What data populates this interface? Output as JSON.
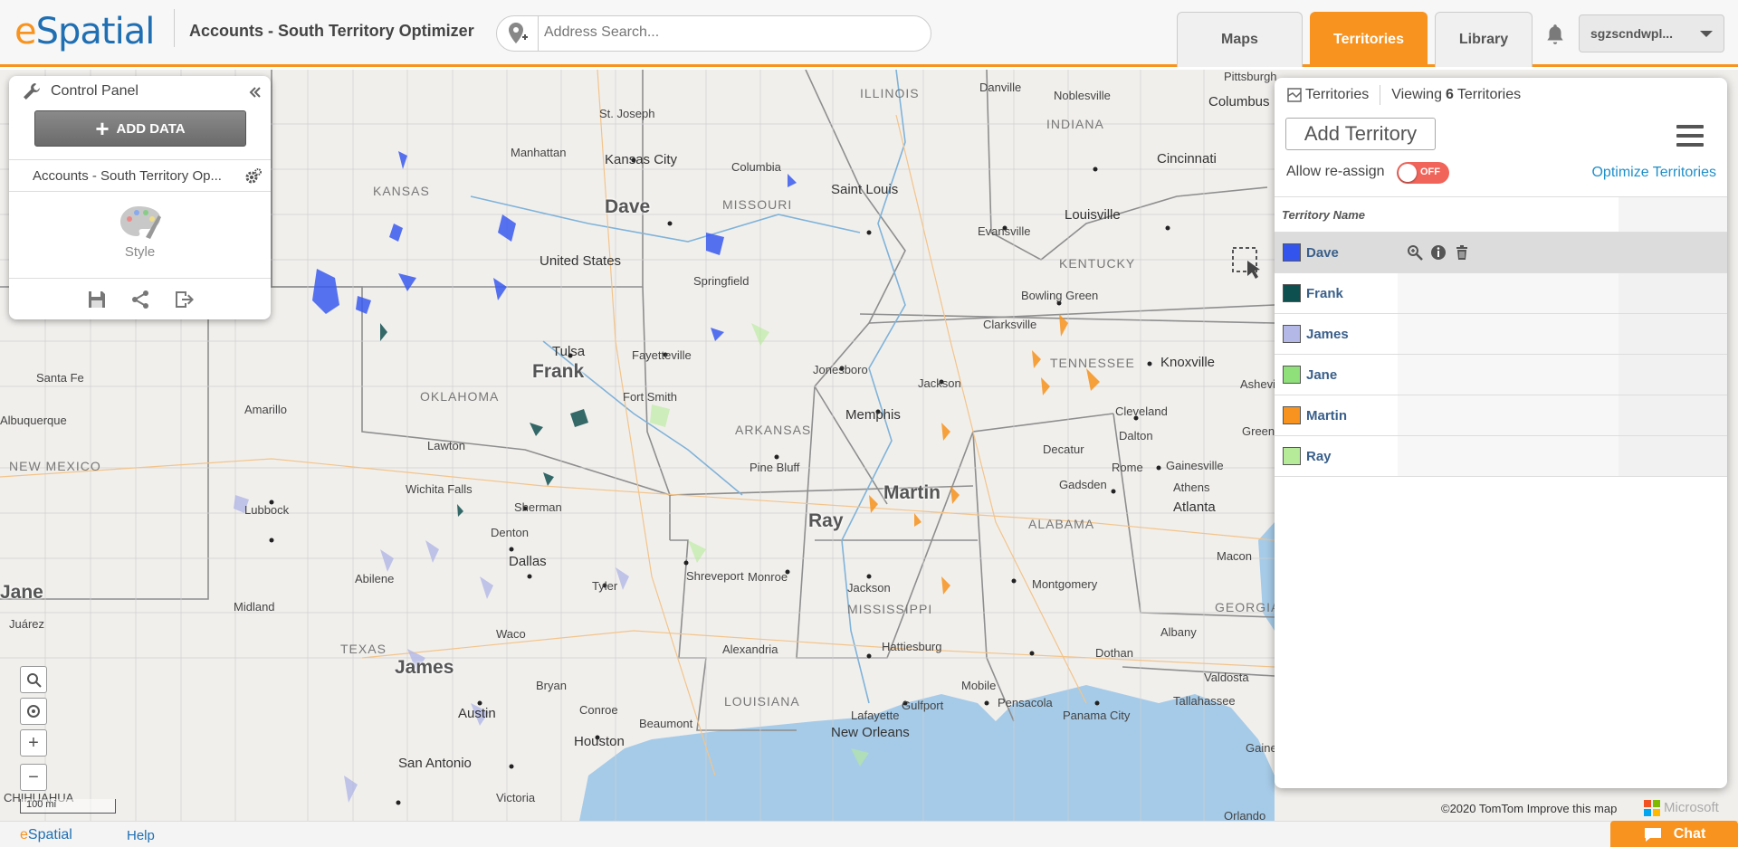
{
  "header": {
    "logo_e": "e",
    "logo_rest": "Spatial",
    "title": "Accounts - South Territory Optimizer",
    "search_placeholder": "Address Search...",
    "tabs": [
      {
        "label": "Maps",
        "active": false
      },
      {
        "label": "Territories",
        "active": true
      },
      {
        "label": "Library",
        "active": false
      }
    ],
    "username": "sgzscndwpl..."
  },
  "control_panel": {
    "title": "Control Panel",
    "add_data_label": "ADD DATA",
    "layer_name": "Accounts - South Territory Op...",
    "style_label": "Style"
  },
  "territories_panel": {
    "header_label": "Territories",
    "viewing_prefix": "Viewing",
    "viewing_count": "6",
    "viewing_suffix": "Territories",
    "add_button": "Add Territory",
    "allow_reassign_label": "Allow re-assign",
    "toggle_state": "OFF",
    "optimize_link": "Optimize Territories",
    "column_header": "Territory Name",
    "rows": [
      {
        "name": "Dave",
        "color": "#3355ee",
        "selected": true
      },
      {
        "name": "Frank",
        "color": "#0e4f4f",
        "selected": false
      },
      {
        "name": "James",
        "color": "#b3b8e6",
        "selected": false
      },
      {
        "name": "Jane",
        "color": "#8fe07a",
        "selected": false
      },
      {
        "name": "Martin",
        "color": "#f7931e",
        "selected": false
      },
      {
        "name": "Ray",
        "color": "#b6eb9a",
        "selected": false
      }
    ]
  },
  "map": {
    "territory_labels": [
      "Dave",
      "Frank",
      "Martin",
      "Ray",
      "James",
      "Jane"
    ],
    "state_labels": [
      "KANSAS",
      "MISSOURI",
      "ILLINOIS",
      "INDIANA",
      "KENTUCKY",
      "TENNESSEE",
      "OKLAHOMA",
      "ARKANSAS",
      "NEW MEXICO",
      "TEXAS",
      "LOUISIANA",
      "MISSISSIPPI",
      "ALABAMA",
      "GEORGIA"
    ],
    "city_labels": [
      "St. Joseph",
      "Manhattan",
      "Kansas City",
      "Columbia",
      "Danville",
      "Noblesville",
      "Columbus",
      "Pittsburgh",
      "Saint Louis",
      "Evansville",
      "Louisville",
      "Cincinnati",
      "Springfield",
      "United States",
      "Bowling Green",
      "Clarksville",
      "Knoxville",
      "Asheville",
      "Tulsa",
      "Fayetteville",
      "Jonesboro",
      "Jackson",
      "Santa Fe",
      "Amarillo",
      "Fort Smith",
      "Memphis",
      "Cleveland",
      "Dalton",
      "Lawton",
      "Albuquerque",
      "Wichita Falls",
      "Pine Bluff",
      "Decatur",
      "Rome",
      "Gainesville",
      "Lubbock",
      "Sherman",
      "Gadsden",
      "Athens",
      "Atlanta",
      "Denton",
      "Dallas",
      "Abilene",
      "Tyler",
      "Shreveport",
      "Monroe",
      "Montgomery",
      "Macon",
      "Midland",
      "Juárez",
      "Waco",
      "Alexandria",
      "Jackson",
      "Hattiesburg",
      "Albany",
      "Dothan",
      "Bryan",
      "Conroe",
      "Austin",
      "Beaumont",
      "Mobile",
      "Valdosta",
      "Tallahassee",
      "Houston",
      "Lafayette",
      "New Orleans",
      "Gulfport",
      "Pensacola",
      "Panama City",
      "San Antonio",
      "Victoria",
      "Orlando",
      "CHIHUAHUA",
      "Green",
      "Gaine"
    ],
    "scale_label": "100 mi",
    "attribution": "©2020 TomTom  Improve this map",
    "provider": "Microsoft"
  },
  "footer": {
    "logo_e": "e",
    "logo_rest": "Spatial",
    "help": "Help",
    "chat": "Chat"
  },
  "colors": {
    "brand_orange": "#f7931e",
    "brand_blue": "#1f6fb2",
    "water": "#a6cbe8",
    "land": "#f1efec"
  }
}
